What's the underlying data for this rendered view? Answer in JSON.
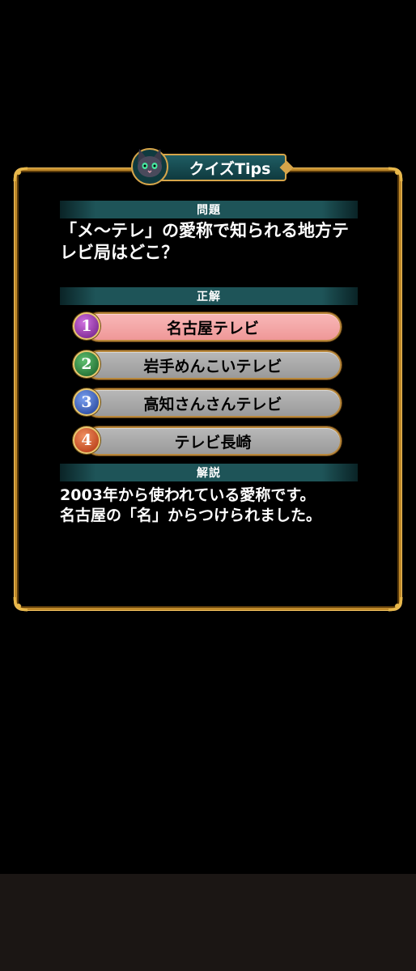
{
  "title": "クイズTips",
  "sections": {
    "question_header": "問題",
    "answer_header": "正解",
    "explanation_header": "解説"
  },
  "question_lines": [
    "「メ〜テレ」の愛称で知られる地方テ",
    "レビ局はどこ？"
  ],
  "choices": [
    {
      "number": "1",
      "label": "名古屋テレビ",
      "correct": true
    },
    {
      "number": "2",
      "label": "岩手めんこいテレビ",
      "correct": false
    },
    {
      "number": "3",
      "label": "高知さんさんテレビ",
      "correct": false
    },
    {
      "number": "4",
      "label": "テレビ長崎",
      "correct": false
    }
  ],
  "explanation_lines": [
    "2003年から使われている愛称です。",
    "名古屋の「名」からつけられました。"
  ],
  "colors": {
    "frame_gold": "#c08a2a",
    "header_teal": "#1e5458",
    "correct_pink": "#f8b8b8",
    "choice_gray": "#a8a8a8"
  },
  "icons": {
    "mascot": "cat-mascot-icon"
  }
}
